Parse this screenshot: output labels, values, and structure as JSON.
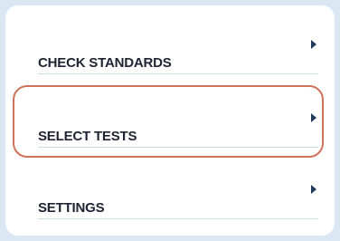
{
  "menu": {
    "items": [
      {
        "label": "CHECK STANDARDS",
        "icon": "chevron-right-icon"
      },
      {
        "label": "SELECT TESTS",
        "icon": "chevron-right-icon",
        "highlighted": true
      },
      {
        "label": "SETTINGS",
        "icon": "chevron-right-icon"
      }
    ]
  },
  "colors": {
    "background": "#dbe8f4",
    "card": "#ffffff",
    "text": "#1f2433",
    "chevron": "#1f3a5a",
    "divider": "#c8dceb",
    "highlight": "#d0735a"
  }
}
